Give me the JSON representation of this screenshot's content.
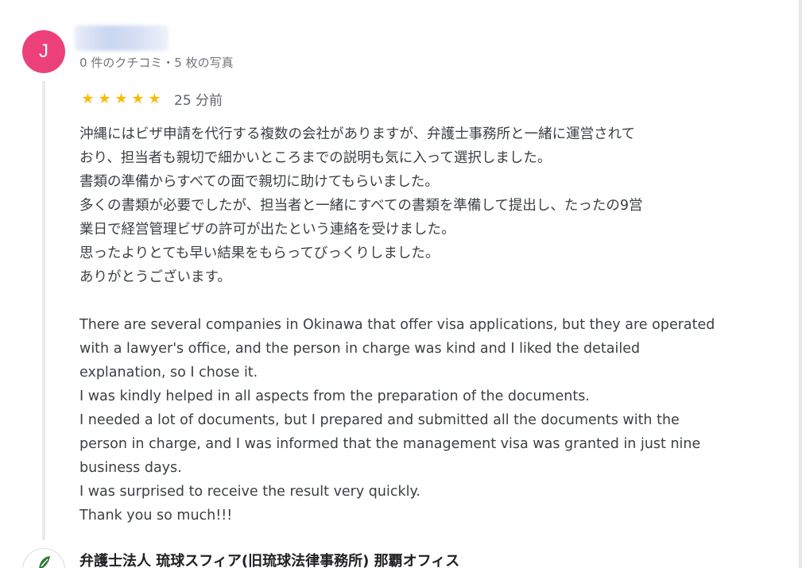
{
  "reviewer": {
    "avatar_letter": "J",
    "avatar_color": "#ec407a",
    "meta": "0 件のクチコミ・5 枚の写真"
  },
  "review": {
    "rating": 5,
    "stars": [
      "★",
      "★",
      "★",
      "★",
      "★"
    ],
    "star_color": "#fbbc04",
    "time_ago": "25 分前",
    "text_lines": [
      "沖縄にはビザ申請を代行する複数の会社がありますが、弁護士事務所と一緒に運営されて",
      "おり、担当者も親切で細かいところまでの説明も気に入って選択しました。",
      "書類の準備からすべての面で親切に助けてもらいました。",
      "多くの書類が必要でしたが、担当者と一緒にすべての書類を準備して提出し、たったの9営",
      "業日で経営管理ビザの許可が出たという連絡を受けました。",
      "思ったよりとても早い結果をもらってびっくりしました。",
      "ありがとうございます。",
      "",
      "There are several companies in Okinawa that offer visa applications, but they are operated",
      "with a lawyer's office, and the person in charge was kind and I liked the detailed",
      "explanation, so I chose it.",
      "I was kindly helped in all aspects from the preparation of the documents.",
      "I needed a lot of documents, but I prepared and submitted all the documents with the",
      "person in charge, and I was informed that the management visa was granted in just nine",
      "business days.",
      "I was surprised to receive the result very quickly.",
      "Thank you so much!!!"
    ]
  },
  "owner_response": {
    "name": "弁護士法人 琉球スフィア(旧琉球法律事務所) 那覇オフィス",
    "logo_icon": "leaf-logo-icon",
    "logo_color": "#2e7d32"
  }
}
